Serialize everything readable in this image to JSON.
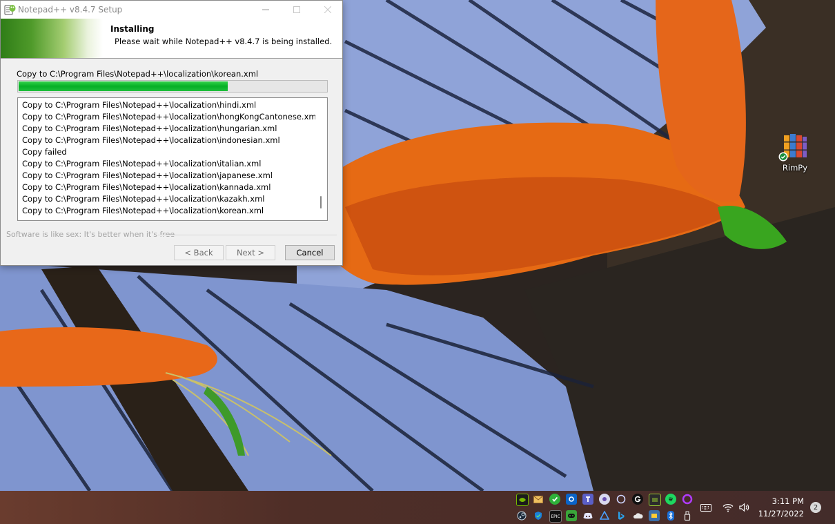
{
  "window": {
    "title": "Notepad++ v8.4.7 Setup",
    "heading": "Installing",
    "subheading": "Please wait while Notepad++ v8.4.7 is being installed.",
    "status": "Copy to C:\\Program Files\\Notepad++\\localization\\korean.xml",
    "progress_fraction": 0.68,
    "log": [
      "Copy to C:\\Program Files\\Notepad++\\localization\\hindi.xml",
      "Copy to C:\\Program Files\\Notepad++\\localization\\hongKongCantonese.xml",
      "Copy to C:\\Program Files\\Notepad++\\localization\\hungarian.xml",
      "Copy to C:\\Program Files\\Notepad++\\localization\\indonesian.xml",
      "Copy failed",
      "Copy to C:\\Program Files\\Notepad++\\localization\\italian.xml",
      "Copy to C:\\Program Files\\Notepad++\\localization\\japanese.xml",
      "Copy to C:\\Program Files\\Notepad++\\localization\\kannada.xml",
      "Copy to C:\\Program Files\\Notepad++\\localization\\kazakh.xml",
      "Copy to C:\\Program Files\\Notepad++\\localization\\korean.xml"
    ],
    "branding": "Software is like sex: It's better when it's free",
    "buttons": {
      "back": "< Back",
      "next": "Next >",
      "cancel": "Cancel"
    }
  },
  "desktop": {
    "icon_label": "RimPy"
  },
  "taskbar": {
    "time": "3:11 PM",
    "date": "11/27/2022",
    "notification_count": "2",
    "epic_label": "EPIC"
  },
  "colors": {
    "progress": "#06b025",
    "banner_green": "#3a8a1f",
    "accent_blue": "#0078d4"
  }
}
